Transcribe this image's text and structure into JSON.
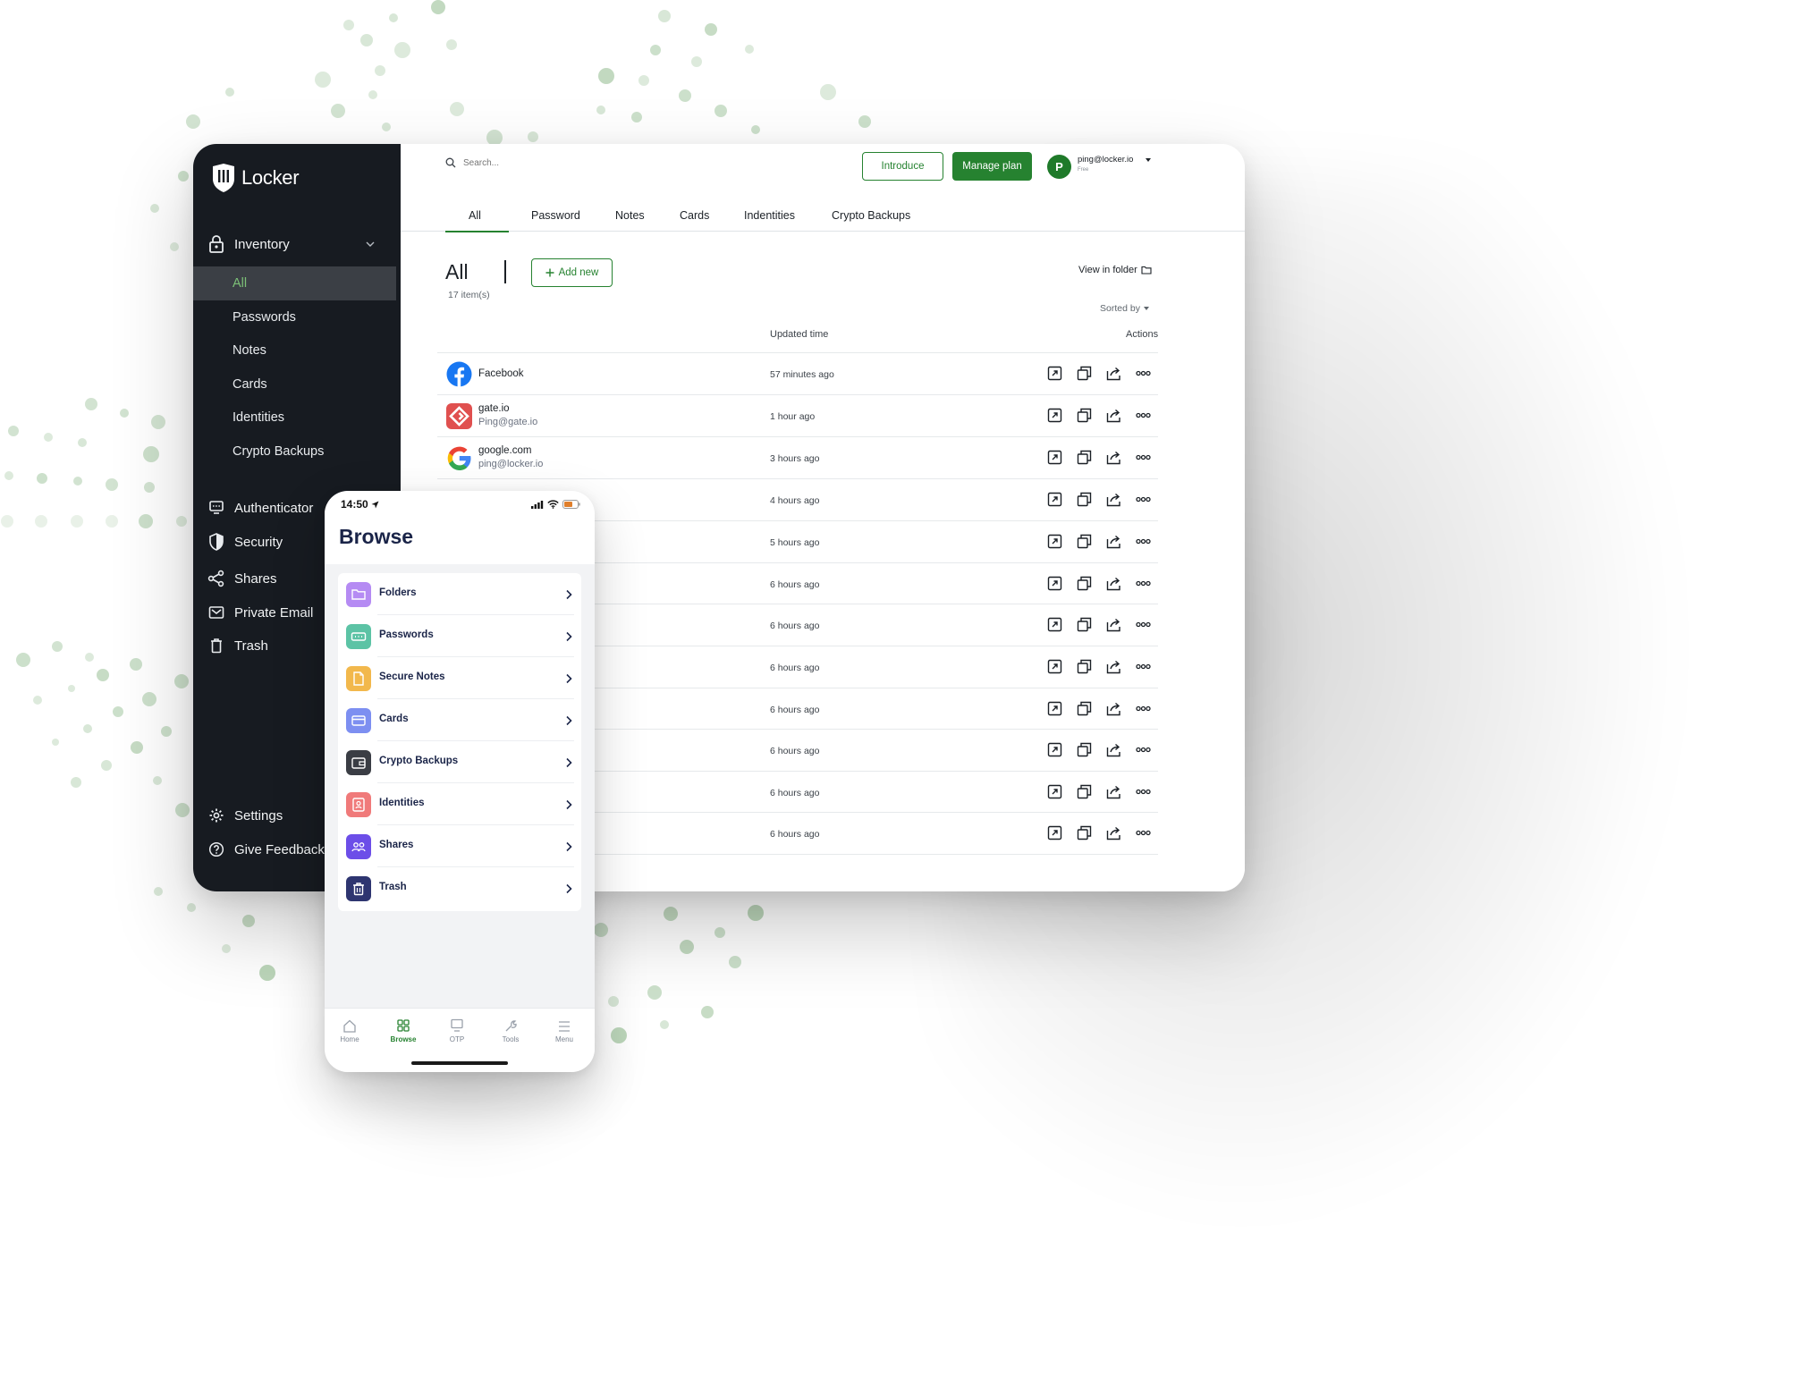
{
  "brand": {
    "name": "Locker",
    "accent": "#268230",
    "sidebar_bg": "#171b21"
  },
  "sidebar": {
    "inventory_label": "Inventory",
    "sub_items": [
      {
        "label": "All",
        "active": true
      },
      {
        "label": "Passwords"
      },
      {
        "label": "Notes"
      },
      {
        "label": "Cards"
      },
      {
        "label": "Identities"
      },
      {
        "label": "Crypto Backups"
      }
    ],
    "items": [
      {
        "label": "Authenticator",
        "icon": "authenticator-icon"
      },
      {
        "label": "Security",
        "icon": "shield-icon"
      },
      {
        "label": "Shares",
        "icon": "share-icon"
      },
      {
        "label": "Private Email",
        "icon": "mail-icon"
      },
      {
        "label": "Trash",
        "icon": "trash-icon"
      }
    ],
    "bottom_items": [
      {
        "label": "Settings",
        "icon": "gear-icon"
      },
      {
        "label": "Give Feedback",
        "icon": "help-icon"
      }
    ]
  },
  "header": {
    "search_placeholder": "Search...",
    "introduce_label": "Introduce",
    "manage_plan_label": "Manage plan",
    "avatar_initial": "P",
    "user_email": "ping@locker.io",
    "user_plan": "Free"
  },
  "tabs": [
    {
      "label": "All",
      "active": true
    },
    {
      "label": "Password"
    },
    {
      "label": "Notes"
    },
    {
      "label": "Cards"
    },
    {
      "label": "Indentities"
    },
    {
      "label": "Crypto Backups"
    }
  ],
  "content": {
    "title": "All",
    "count": "17 item(s)",
    "add_new_label": "Add new",
    "view_in_folder_label": "View in folder",
    "sorted_by_label": "Sorted by",
    "col_updated": "Updated time",
    "col_actions": "Actions"
  },
  "rows": [
    {
      "name": "Facebook",
      "sub": "",
      "time": "57 minutes ago",
      "icon": "facebook-icon"
    },
    {
      "name": "gate.io",
      "sub": "Ping@gate.io",
      "time": "1 hour ago",
      "icon": "gateio-icon"
    },
    {
      "name": "google.com",
      "sub": "ping@locker.io",
      "time": "3 hours ago",
      "icon": "google-icon"
    },
    {
      "name": "",
      "sub": "",
      "time": "4 hours ago",
      "icon": ""
    },
    {
      "name": "",
      "sub": "",
      "time": "5 hours ago",
      "icon": ""
    },
    {
      "name": "",
      "sub": "",
      "time": "6 hours ago",
      "icon": ""
    },
    {
      "name": "",
      "sub": "",
      "time": "6 hours ago",
      "icon": ""
    },
    {
      "name": "",
      "sub": "",
      "time": "6 hours ago",
      "icon": ""
    },
    {
      "name": "",
      "sub": "",
      "time": "6 hours ago",
      "icon": ""
    },
    {
      "name": "",
      "sub": "",
      "time": "6 hours ago",
      "icon": ""
    },
    {
      "name": "",
      "sub": "",
      "time": "6 hours ago",
      "icon": ""
    },
    {
      "name": "",
      "sub": "",
      "time": "6 hours ago",
      "icon": ""
    }
  ],
  "phone": {
    "time": "14:50",
    "title": "Browse",
    "items": [
      {
        "label": "Folders",
        "icon": "folder-icon",
        "color": "#b58bf3"
      },
      {
        "label": "Passwords",
        "icon": "password-icon",
        "color": "#5cc3a5"
      },
      {
        "label": "Secure Notes",
        "icon": "note-icon",
        "color": "#f2b84c"
      },
      {
        "label": "Cards",
        "icon": "card-icon",
        "color": "#7d8ff1"
      },
      {
        "label": "Crypto Backups",
        "icon": "wallet-icon",
        "color": "#3a3d44"
      },
      {
        "label": "Identities",
        "icon": "identity-icon",
        "color": "#f07a7a"
      },
      {
        "label": "Shares",
        "icon": "shares-icon",
        "color": "#6c4ee8"
      },
      {
        "label": "Trash",
        "icon": "trash-icon",
        "color": "#2e3570"
      }
    ],
    "tabbar": [
      {
        "label": "Home",
        "icon": "home-icon"
      },
      {
        "label": "Browse",
        "icon": "browse-icon",
        "active": true
      },
      {
        "label": "OTP",
        "icon": "otp-icon"
      },
      {
        "label": "Tools",
        "icon": "tools-icon"
      },
      {
        "label": "Menu",
        "icon": "menu-icon"
      }
    ]
  }
}
